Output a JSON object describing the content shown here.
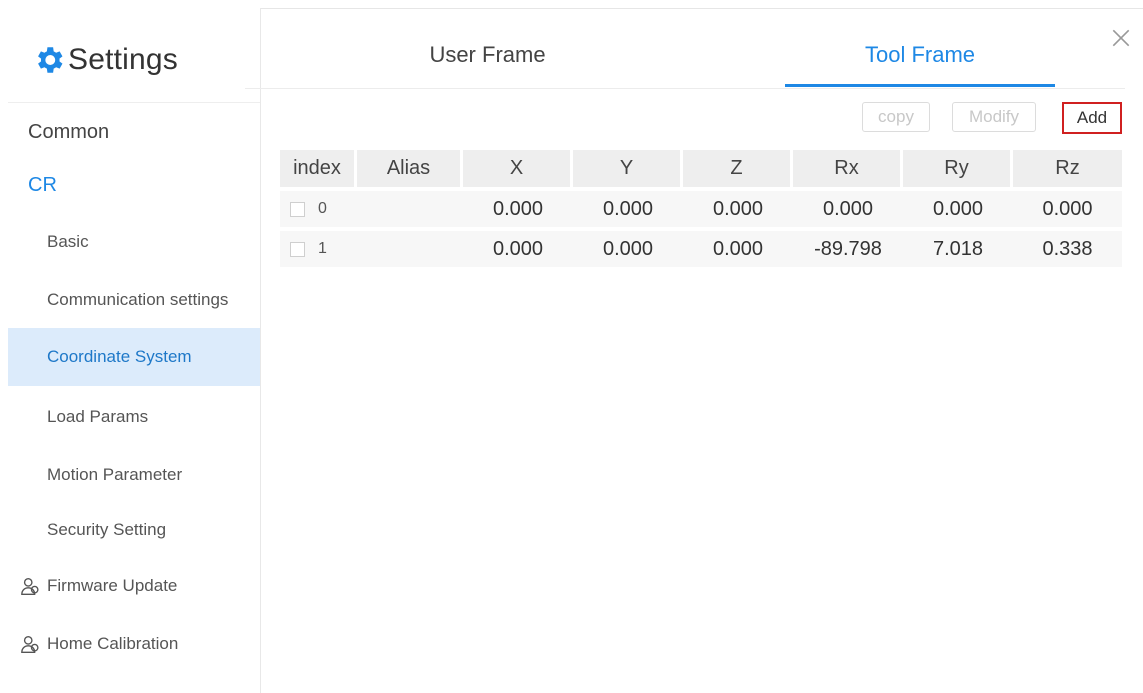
{
  "sidebar": {
    "title": "Settings",
    "items": [
      {
        "label": "Common"
      },
      {
        "label": "CR"
      },
      {
        "label": "Basic"
      },
      {
        "label": "Communication settings"
      },
      {
        "label": "Coordinate System"
      },
      {
        "label": "Load Params"
      },
      {
        "label": "Motion Parameter"
      },
      {
        "label": "Security Setting"
      },
      {
        "label": "Firmware Update"
      },
      {
        "label": "Home Calibration"
      }
    ]
  },
  "tabs": [
    {
      "label": "User Frame"
    },
    {
      "label": "Tool Frame"
    }
  ],
  "toolbar": {
    "copy_label": "copy",
    "modify_label": "Modify",
    "add_label": "Add"
  },
  "table": {
    "columns": [
      "index",
      "Alias",
      "X",
      "Y",
      "Z",
      "Rx",
      "Ry",
      "Rz"
    ],
    "rows": [
      {
        "index": "0",
        "alias": "",
        "x": "0.000",
        "y": "0.000",
        "z": "0.000",
        "rx": "0.000",
        "ry": "0.000",
        "rz": "0.000"
      },
      {
        "index": "1",
        "alias": "",
        "x": "0.000",
        "y": "0.000",
        "z": "0.000",
        "rx": "-89.798",
        "ry": "7.018",
        "rz": "0.338"
      }
    ]
  },
  "colors": {
    "accent": "#1e88e5",
    "active_bg": "#dcebfb",
    "highlight_border": "#d02020"
  },
  "icons": [
    "gear-icon",
    "close-icon",
    "user-icon"
  ]
}
